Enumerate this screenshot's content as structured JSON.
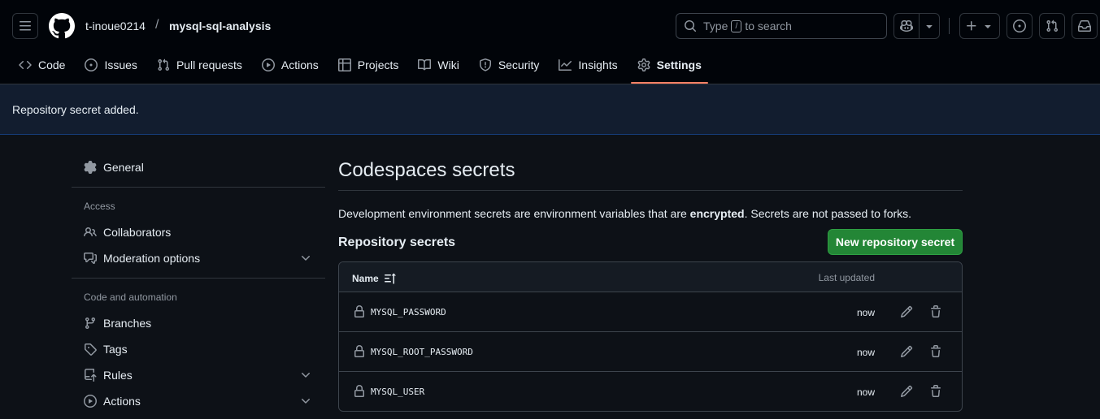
{
  "header": {
    "owner": "t-inoue0214",
    "separator": "/",
    "repo": "mysql-sql-analysis",
    "search_prefix": "Type",
    "search_key": "/",
    "search_suffix": "to search"
  },
  "tabs": [
    {
      "label": "Code",
      "icon": "code-icon"
    },
    {
      "label": "Issues",
      "icon": "issue-icon"
    },
    {
      "label": "Pull requests",
      "icon": "pull-request-icon"
    },
    {
      "label": "Actions",
      "icon": "play-icon"
    },
    {
      "label": "Projects",
      "icon": "table-icon"
    },
    {
      "label": "Wiki",
      "icon": "book-icon"
    },
    {
      "label": "Security",
      "icon": "shield-icon"
    },
    {
      "label": "Insights",
      "icon": "graph-icon"
    },
    {
      "label": "Settings",
      "icon": "gear-icon",
      "active": true
    }
  ],
  "flash": {
    "message": "Repository secret added."
  },
  "sidebar": {
    "general": "General",
    "access_heading": "Access",
    "collaborators": "Collaborators",
    "moderation": "Moderation options",
    "code_heading": "Code and automation",
    "branches": "Branches",
    "tags": "Tags",
    "rules": "Rules",
    "actions": "Actions"
  },
  "main": {
    "title": "Codespaces secrets",
    "desc_before": "Development environment secrets are environment variables that are ",
    "desc_bold": "encrypted",
    "desc_after": ". Secrets are not passed to forks.",
    "section_title": "Repository secrets",
    "new_button": "New repository secret",
    "table": {
      "col_name": "Name",
      "col_updated": "Last updated",
      "rows": [
        {
          "name": "MYSQL_PASSWORD",
          "updated": "now"
        },
        {
          "name": "MYSQL_ROOT_PASSWORD",
          "updated": "now"
        },
        {
          "name": "MYSQL_USER",
          "updated": "now"
        }
      ]
    }
  },
  "colors": {
    "background": "#0d1117",
    "header_bg": "#010409",
    "flash_bg": "#121d2f",
    "primary_button": "#238636",
    "active_tab_underline": "#f78166"
  }
}
